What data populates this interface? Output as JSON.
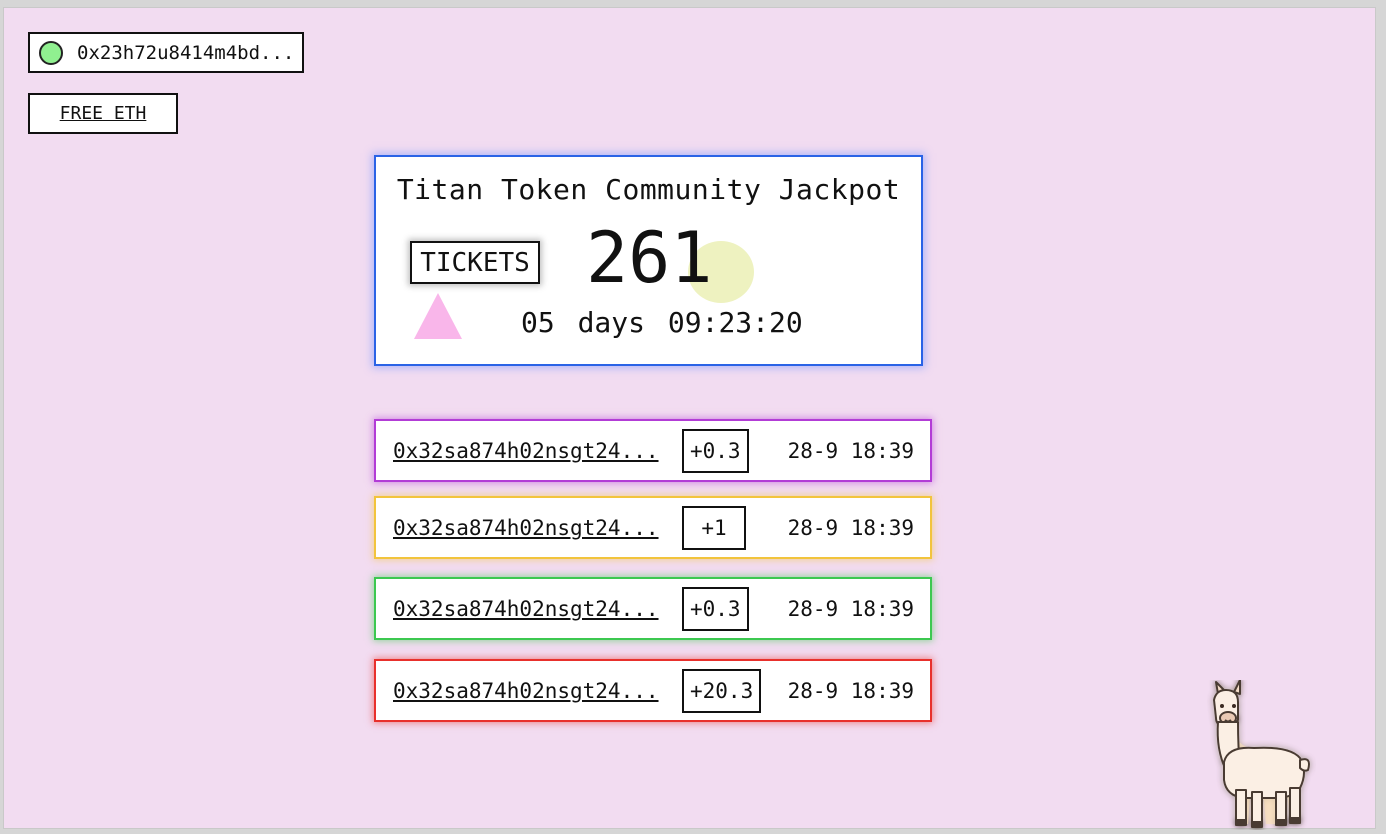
{
  "wallet": {
    "address": "0x23h72u8414m4bd...",
    "status_color": "#90f090"
  },
  "faucet": {
    "label": "FREE ETH"
  },
  "jackpot": {
    "title": "Titan Token Community Jackpot",
    "tickets_label": "TICKETS",
    "ticket_count": "261",
    "countdown_days": "05 days",
    "countdown_time": "09:23:20",
    "accent_color": "#2a63e6"
  },
  "transactions": [
    {
      "address": "0x32sa874h02nsgt24...",
      "amount": "+0.3",
      "time": "28-9 18:39",
      "color": "#b23cd6"
    },
    {
      "address": "0x32sa874h02nsgt24...",
      "amount": "+1",
      "time": "28-9 18:39",
      "color": "#f2c43c"
    },
    {
      "address": "0x32sa874h02nsgt24...",
      "amount": "+0.3",
      "time": "28-9 18:39",
      "color": "#3cc850"
    },
    {
      "address": "0x32sa874h02nsgt24...",
      "amount": "+20.3",
      "time": "28-9 18:39",
      "color": "#e8302c"
    }
  ],
  "mascot": {
    "icon": "llama-icon"
  }
}
